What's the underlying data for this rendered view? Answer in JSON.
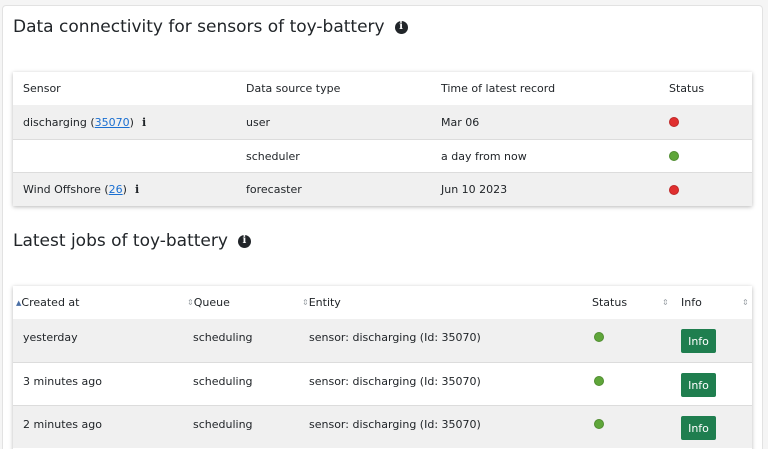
{
  "connectivity": {
    "title": "Data connectivity for sensors of toy-battery",
    "columns": [
      "Sensor",
      "Data source type",
      "Time of latest record",
      "Status"
    ],
    "rows": [
      {
        "sensor_name": "discharging",
        "sensor_open": " (",
        "sensor_id": "35070",
        "sensor_close": ")",
        "source_type": "user",
        "latest": "Mar 06",
        "status": "red"
      },
      {
        "sensor_name": "",
        "sensor_open": "",
        "sensor_id": "",
        "sensor_close": "",
        "source_type": "scheduler",
        "latest": "a day from now",
        "status": "green"
      },
      {
        "sensor_name": "Wind Offshore",
        "sensor_open": " (",
        "sensor_id": "26",
        "sensor_close": ")",
        "source_type": "forecaster",
        "latest": "Jun 10 2023",
        "status": "red"
      }
    ]
  },
  "jobs": {
    "title": "Latest jobs of toy-battery",
    "columns": [
      "Created at",
      "Queue",
      "Entity",
      "Status",
      "Info"
    ],
    "rows": [
      {
        "created": "yesterday",
        "queue": "scheduling",
        "entity": "sensor: discharging (Id: 35070)",
        "status": "green",
        "button": "Info"
      },
      {
        "created": "3 minutes ago",
        "queue": "scheduling",
        "entity": "sensor: discharging (Id: 35070)",
        "status": "green",
        "button": "Info"
      },
      {
        "created": "2 minutes ago",
        "queue": "scheduling",
        "entity": "sensor: discharging (Id: 35070)",
        "status": "green",
        "button": "Info"
      }
    ]
  },
  "colors": {
    "status_red": "#e02f2f",
    "status_green": "#5fa63a",
    "button_green": "#1f7e4f",
    "link_blue": "#1a6fd1"
  }
}
